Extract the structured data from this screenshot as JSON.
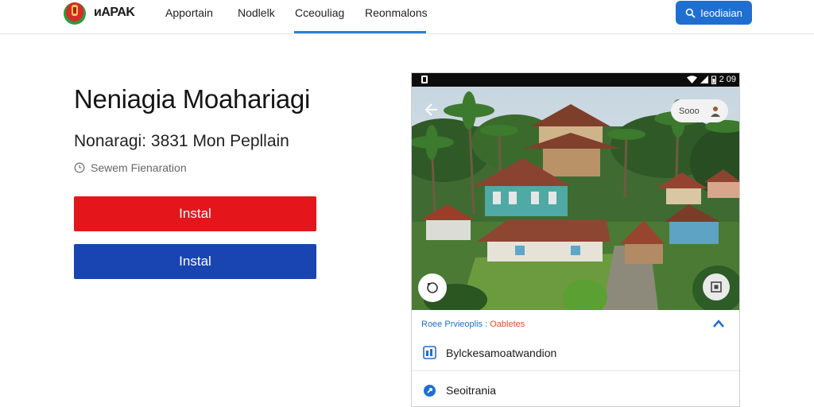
{
  "header": {
    "brand": "ᴎAPAK",
    "nav": [
      {
        "label": "Apportain"
      },
      {
        "label": "Nodlelk"
      },
      {
        "label": "Cceouliag"
      },
      {
        "label": "Reonmalons"
      }
    ],
    "active_nav_index": 2,
    "signin_label": "Ieodiaian"
  },
  "main": {
    "title": "Neniagia Moahariagi",
    "subtitle": "Nonaragi: 3831 Mon Pepllain",
    "meta": "Sewem Fienaration",
    "primary_button": "Instal",
    "secondary_button": "Instal"
  },
  "phone": {
    "status_time": "2 09",
    "search_pill": "Sooo",
    "panel": {
      "head_label": "Roee Prvieoplis : ",
      "head_accent": "Oabletes",
      "rows": [
        {
          "label": "Bylckesamoatwandion",
          "icon": "grid-icon"
        },
        {
          "label": "Seoitrania",
          "icon": "pin-icon"
        }
      ]
    }
  },
  "colors": {
    "accent_blue": "#1f6fd0",
    "install_red": "#e4161b",
    "install_blue": "#1845b1",
    "nav_underline": "#2a7fd6"
  }
}
